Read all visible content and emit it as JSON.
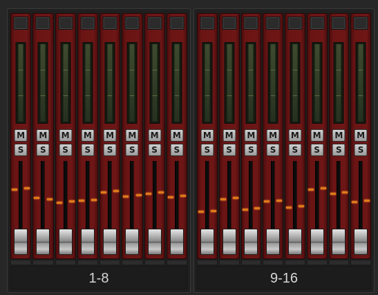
{
  "banks": [
    {
      "label": "1-8",
      "channels": 8,
      "levels": [
        0.62,
        0.5,
        0.43,
        0.46,
        0.58,
        0.52,
        0.56,
        0.51
      ],
      "levels_right": [
        0.64,
        0.48,
        0.45,
        0.47,
        0.6,
        0.54,
        0.58,
        0.53
      ]
    },
    {
      "label": "9-16",
      "channels": 8,
      "levels": [
        0.3,
        0.48,
        0.33,
        0.45,
        0.36,
        0.62,
        0.56,
        0.44
      ],
      "levels_right": [
        0.31,
        0.5,
        0.35,
        0.46,
        0.38,
        0.64,
        0.58,
        0.46
      ]
    }
  ],
  "buttons": {
    "mute_label": "M",
    "solo_label": "S"
  },
  "colors": {
    "strip": "#6e1616",
    "level_mark": "#e07a1a",
    "meter": "#263020"
  }
}
